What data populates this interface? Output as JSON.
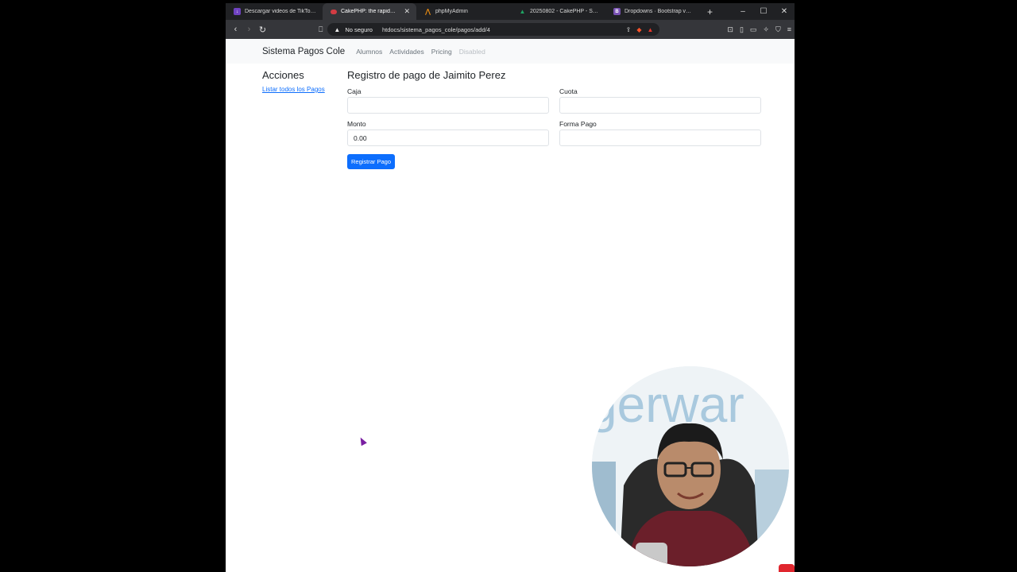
{
  "browser": {
    "tabs": [
      {
        "label": "Descargar videos de TikTok sin",
        "favicon_color": "#6f42c1",
        "favicon_glyph": "↓",
        "active": false
      },
      {
        "label": "CakePHP: the rapid develo",
        "favicon_color": "#d33c43",
        "favicon_glyph": "",
        "active": true
      },
      {
        "label": "phpMyAdmin",
        "favicon_color": "#f29111",
        "favicon_glyph": "",
        "active": false
      },
      {
        "label": "20250802 - CakePHP - Sistema",
        "favicon_color": "#1fa463",
        "favicon_glyph": "",
        "active": false
      },
      {
        "label": "Dropdowns · Bootstrap v5.3",
        "favicon_color": "#7952b3",
        "favicon_glyph": "B",
        "active": false
      }
    ],
    "security_label": "No seguro",
    "url": "htdocs/sistema_pagos_cole/pagos/add/4"
  },
  "navbar": {
    "brand": "Sistema Pagos Cole",
    "links": [
      "Alumnos",
      "Actividades",
      "Pricing"
    ],
    "disabled_link": "Disabled"
  },
  "sidebar": {
    "heading": "Acciones",
    "link": "Listar todos los Pagos"
  },
  "form": {
    "title": "Registro de pago de Jaimito Perez",
    "fields": {
      "caja": {
        "label": "Caja",
        "value": ""
      },
      "cuota": {
        "label": "Cuota",
        "value": ""
      },
      "monto": {
        "label": "Monto",
        "value": "0.00"
      },
      "forma_pago": {
        "label": "Forma Pago",
        "value": ""
      }
    },
    "submit_label": "Registrar Pago"
  },
  "colors": {
    "primary": "#0d6efd",
    "navbar_bg": "#f8f9fa",
    "browser_dark": "#202124"
  }
}
